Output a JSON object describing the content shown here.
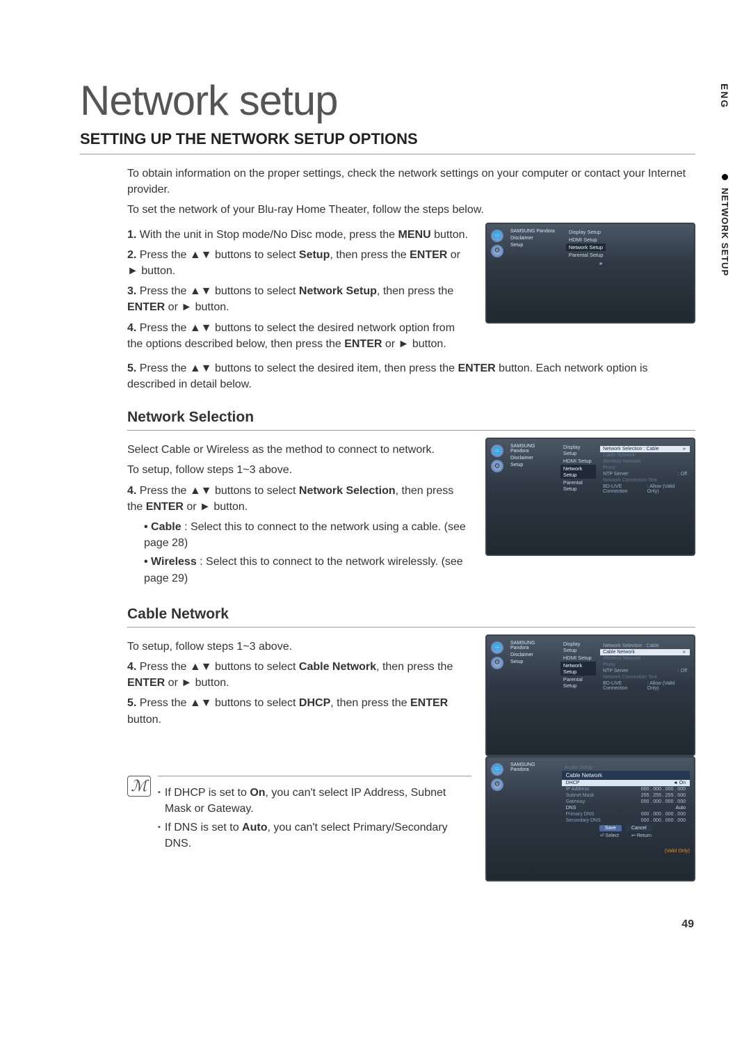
{
  "title": "Network setup",
  "section_heading": "SETTING UP THE NETWORK SETUP OPTIONS",
  "intro1": "To obtain information on the proper settings, check the network settings on your computer or contact your Internet provider.",
  "intro2": "To set the network of your Blu-ray Home Theater, follow the steps below.",
  "steps_top": {
    "1": {
      "n": "1.",
      "a": "With the unit in Stop mode/No Disc mode, press the ",
      "b": "MENU",
      "c": " button."
    },
    "2": {
      "n": "2.",
      "a": "Press the ▲▼ buttons to select ",
      "b": "Setup",
      "c": ", then press the ",
      "d": "ENTER",
      "e": " or ► button."
    },
    "3": {
      "n": "3.",
      "a": "Press the ▲▼ buttons to select ",
      "b": "Network Setup",
      "c": ", then press the ",
      "d": "ENTER",
      "e": " or ► button."
    },
    "4": {
      "n": "4.",
      "a": "Press the ▲▼ buttons to select the desired network option from the options described below, then press the ",
      "b": "ENTER",
      "c": " or ► button."
    },
    "5": {
      "n": "5.",
      "a": "Press the ▲▼ buttons to select the desired item, then press the ",
      "b": "ENTER",
      "c": " button. Each network option is described in detail below."
    }
  },
  "sub_network_selection": "Network Selection",
  "ns_intro": "Select Cable or Wireless as the method to connect to network.",
  "ns_setup": "To setup, follow steps 1~3 above.",
  "ns_step4": {
    "n": "4.",
    "a": "Press the ▲▼ buttons to select ",
    "b": "Network Selection",
    "c": ", then press the ",
    "d": "ENTER",
    "e": " or ► button."
  },
  "ns_bullets": {
    "cable": {
      "b": "Cable",
      "t": " : Select this to connect to the network using a cable. (see page 28)"
    },
    "wireless": {
      "b": "Wireless",
      "t": " : Select this to connect to the network wirelessly. (see page 29)"
    }
  },
  "sub_cable_network": "Cable Network",
  "cn_setup": "To setup, follow steps 1~3 above.",
  "cn_step4": {
    "n": "4.",
    "a": "Press the ▲▼ buttons to select ",
    "b": "Cable Network",
    "c": ", then press the ",
    "d": "ENTER",
    "e": " or ► button."
  },
  "cn_step5": {
    "n": "5.",
    "a": "Press the ▲▼ buttons to select ",
    "b": "DHCP",
    "c": ", then press the ",
    "d": "ENTER",
    "e": " button."
  },
  "notes": {
    "n1": {
      "a": "If DHCP is set to ",
      "b": "On",
      "c": ", you can't select IP Address, Subnet Mask or Gateway."
    },
    "n2": {
      "a": "If DNS is set to ",
      "b": "Auto",
      "c": ", you can't select Primary/Secondary DNS."
    }
  },
  "side": {
    "lang": "ENG",
    "section": "NETWORK SETUP"
  },
  "page_number": "49",
  "shot1": {
    "brand": "SAMSUNG",
    "tab1": "Pandora",
    "tab2": "Disclaimer",
    "tab3": "Setup",
    "m1": "Display Setup",
    "m2": "HDMI Setup",
    "m3": "Network Setup",
    "m4": "Parental Setup",
    "arrow": "►"
  },
  "shot2": {
    "brand": "SAMSUNG",
    "tab1": "Pandora",
    "tab2": "Disclaimer",
    "tab3": "Setup",
    "m1": "Display Setup",
    "m2": "HDMI Setup",
    "m3": "Network Setup",
    "m4": "Parental Setup",
    "s1l": "Network Selection :",
    "s1v": "Cable",
    "arr": "►",
    "s2": "Cable Network",
    "s3": "Wireless Network",
    "s4": "Proxy",
    "s5l": "NTP Server",
    "s5v": ": Off",
    "s6": "Network Connection Test",
    "s7l": "BD-LIVE Connection",
    "s7v": ": Allow (Valid Only)"
  },
  "shot3": {
    "brand": "SAMSUNG",
    "tab1": "Pandora",
    "tab2": "Disclaimer",
    "tab3": "Setup",
    "m1": "Display Setup",
    "m2": "HDMI Setup",
    "m3": "Network Setup",
    "m4": "Parental Setup",
    "s1l": "Network Selection :",
    "s1v": "Cable",
    "s2": "Cable Network",
    "arr": "►",
    "s3": "Wireless Network",
    "s4": "Proxy",
    "s5l": "NTP Server",
    "s5v": ": Off",
    "s6": "Network Connection Test",
    "s7l": "BD-LIVE Connection",
    "s7v": ": Allow (Valid Only)"
  },
  "shot4": {
    "brand": "SAMSUNG",
    "tab1": "Pandora",
    "m0": "Audio Setup",
    "hdr": "Cable Network",
    "r1l": "DHCP",
    "r1v": "On",
    "arr": "◄",
    "r2l": "IP Address",
    "r2v": "000 . 000 . 000 . 000",
    "r3l": "Subnet Mask",
    "r3v": "255 . 255 . 255 . 000",
    "r4l": "Gateway",
    "r4v": "000 . 000 . 000 . 000",
    "r5l": "DNS",
    "r5v": "Auto",
    "r6l": "Primary DNS",
    "r6v": "000 . 000 . 000 . 000",
    "r7l": "Secondary DNS",
    "r7v": "000 . 000 . 000 . 000",
    "valid": "(Valid Only)",
    "btn_save": "Save",
    "btn_cancel": "Cancel",
    "foot_sel": "Select",
    "foot_ret": "Return",
    "foot_sel_icon": "⏎",
    "foot_ret_icon": "↩"
  }
}
